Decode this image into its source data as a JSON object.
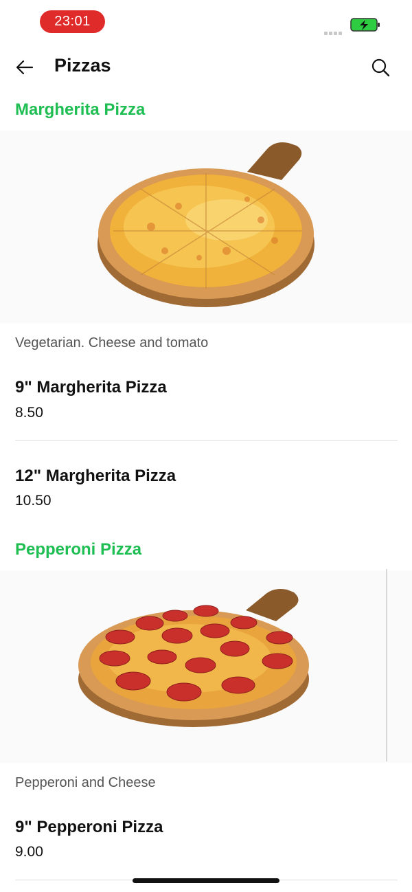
{
  "status": {
    "time": "23:01"
  },
  "header": {
    "title": "Pizzas"
  },
  "sections": [
    {
      "title": "Margherita Pizza",
      "description": "Vegetarian. Cheese and tomato",
      "items": [
        {
          "name": "9\" Margherita Pizza",
          "price": "8.50"
        },
        {
          "name": "12\" Margherita Pizza",
          "price": "10.50"
        }
      ]
    },
    {
      "title": "Pepperoni Pizza",
      "description": "Pepperoni and Cheese",
      "items": [
        {
          "name": "9\" Pepperoni Pizza",
          "price": "9.00"
        }
      ]
    }
  ],
  "icons": {
    "back": "arrow-left-icon",
    "search": "search-icon",
    "battery": "battery-charging-icon"
  },
  "colors": {
    "accent": "#1fbe53",
    "time_pill": "#e02b2b",
    "battery": "#2ecc40"
  }
}
